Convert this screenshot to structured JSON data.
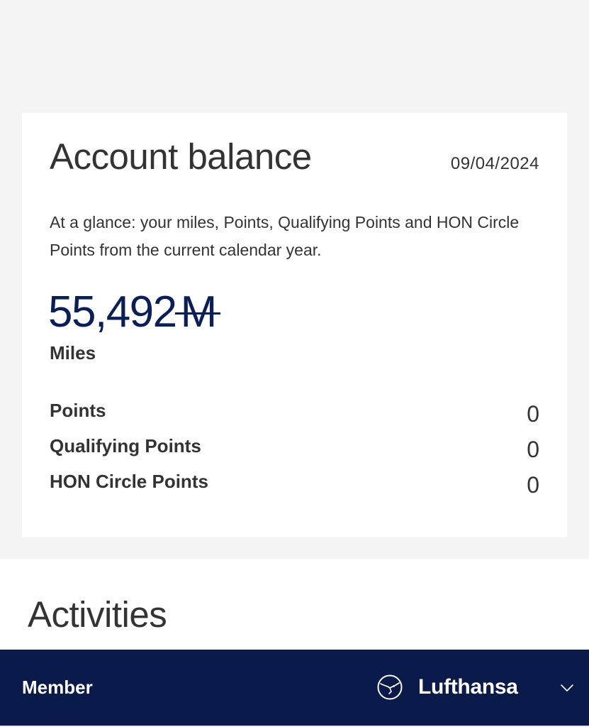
{
  "balance": {
    "title": "Account balance",
    "date": "09/04/2024",
    "description": "At a glance: your miles, Points, Qualifying Points and HON Circle Points from the current calendar year.",
    "miles_value": "55,492",
    "miles_unit": "M",
    "miles_label": "Miles",
    "points": [
      {
        "label": "Points",
        "value": "0"
      },
      {
        "label": "Qualifying Points",
        "value": "0"
      },
      {
        "label": "HON Circle Points",
        "value": "0"
      }
    ]
  },
  "activities": {
    "title": "Activities"
  },
  "bottom_bar": {
    "member_label": "Member",
    "brand": "Lufthansa",
    "logo_icon": "lufthansa-crane-icon",
    "chevron_icon": "chevron-down-icon"
  },
  "colors": {
    "background": "#f4f4f4",
    "card": "#ffffff",
    "accent_navy": "#0a1e5a",
    "bar_navy": "#0a1a4a",
    "text": "#333333"
  }
}
